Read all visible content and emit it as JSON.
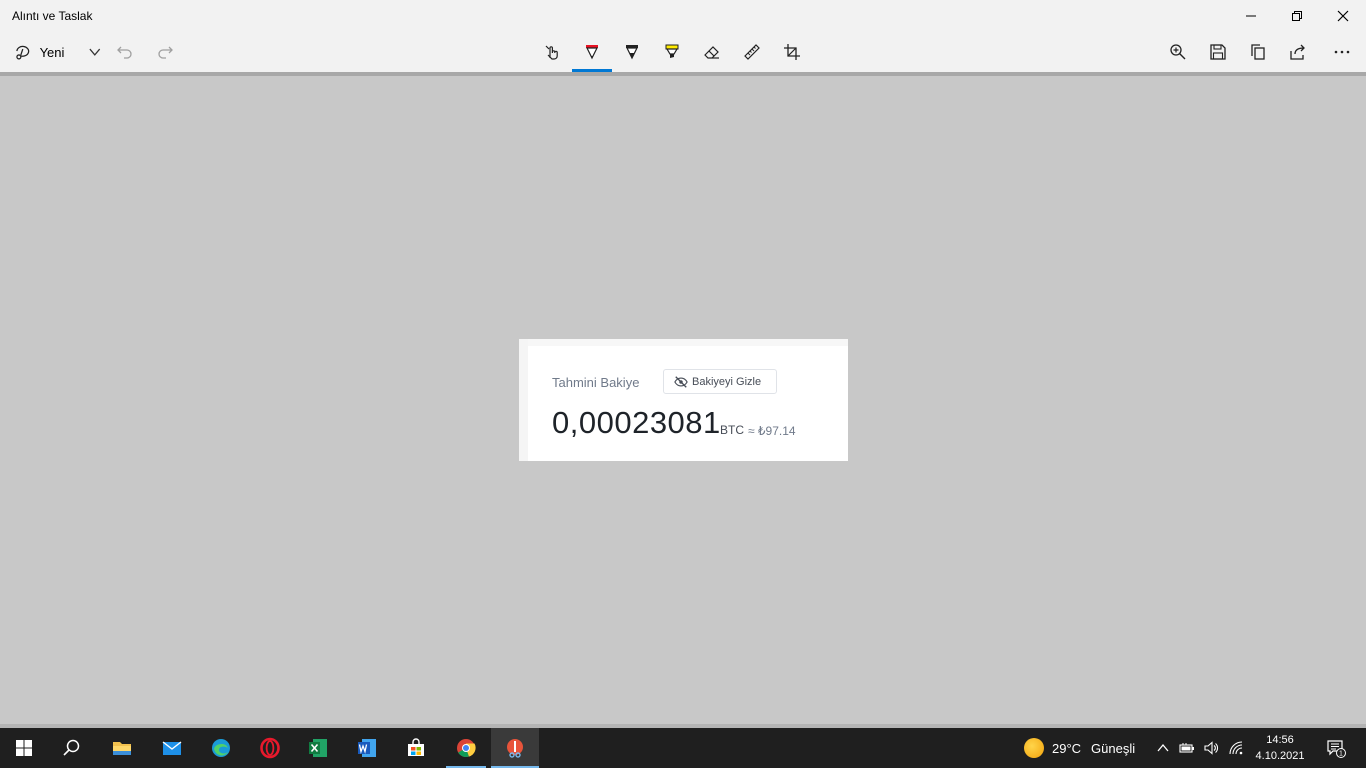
{
  "window": {
    "title": "Alıntı ve Taslak",
    "controls": [
      "minimize",
      "restore",
      "close"
    ]
  },
  "toolbar": {
    "new_label": "Yeni",
    "left_tools": [
      "snip-new-icon",
      "chevron-down-icon",
      "undo-icon",
      "redo-icon"
    ],
    "center_tools": [
      "touch-writing-icon",
      "ballpoint-pen-icon",
      "pencil-icon",
      "highlighter-icon",
      "eraser-icon",
      "ruler-icon",
      "crop-icon"
    ],
    "active_tool": "ballpoint-pen-icon",
    "right_tools": [
      "zoom-icon",
      "save-icon",
      "copy-icon",
      "share-icon",
      "more-icon"
    ],
    "colors": {
      "accent": "#0078d4",
      "pen": "#e81123",
      "highlighter": "#ffeb00"
    }
  },
  "content": {
    "balance_label": "Tahmini Bakiye",
    "hide_balance_label": "Bakiyeyi Gizle",
    "balance_value": "0,00023081",
    "balance_unit": "BTC",
    "balance_approx": "≈ ₺97.14"
  },
  "taskbar": {
    "apps": [
      "start-icon",
      "search-icon",
      "file-explorer-icon",
      "mail-icon",
      "edge-icon",
      "opera-icon",
      "excel-icon",
      "word-icon",
      "store-icon",
      "chrome-icon",
      "snip-sketch-icon"
    ],
    "weather_temp": "29°C",
    "weather_desc": "Güneşli",
    "time": "14:56",
    "date": "4.10.2021",
    "notification_count": "1"
  }
}
